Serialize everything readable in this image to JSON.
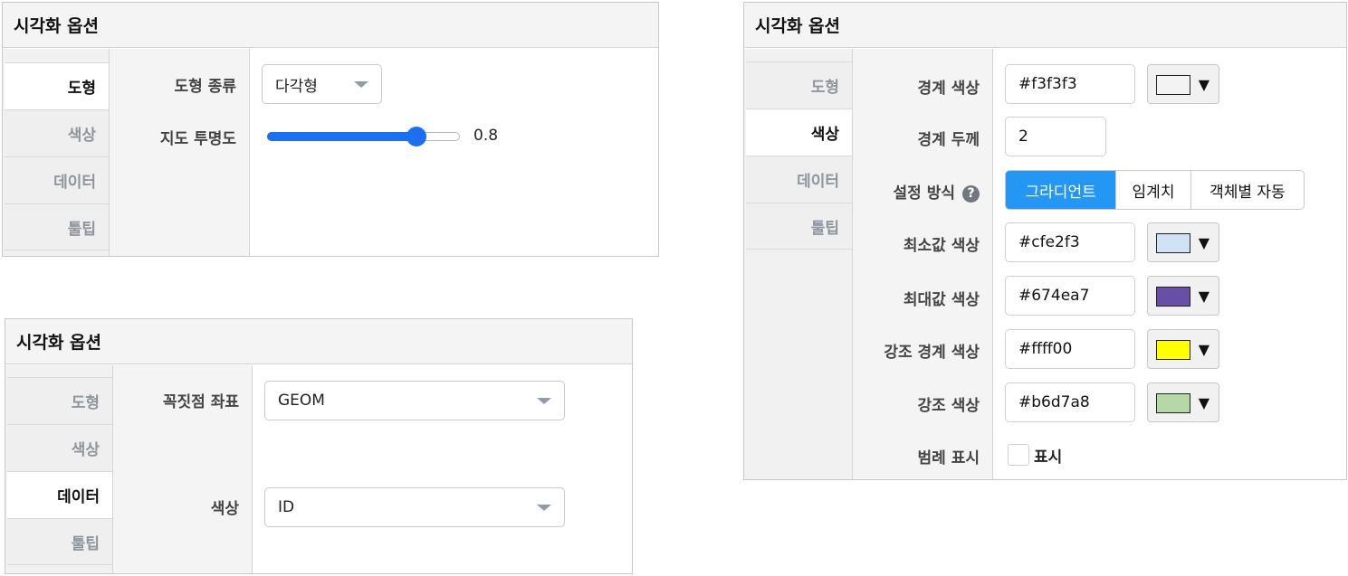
{
  "panels": {
    "shape": {
      "title": "시각화 옵션",
      "tabs": [
        "도형",
        "색상",
        "데이터",
        "툴팁"
      ],
      "fields": {
        "shape_type_label": "도형 종류",
        "shape_type_value": "다각형",
        "opacity_label": "지도 투명도",
        "opacity_value": "0.8",
        "opacity_level": 0.8
      }
    },
    "data": {
      "title": "시각화 옵션",
      "tabs": [
        "도형",
        "색상",
        "데이터",
        "툴팁"
      ],
      "fields": {
        "vertex_label": "꼭짓점 좌표",
        "vertex_value": "GEOM",
        "color_label": "색상",
        "color_value": "ID"
      }
    },
    "color": {
      "title": "시각화 옵션",
      "tabs": [
        "도형",
        "색상",
        "데이터",
        "툴팁"
      ],
      "fields": {
        "border_color_label": "경계 색상",
        "border_color_value": "#f3f3f3",
        "border_width_label": "경계 두께",
        "border_width_value": "2",
        "mode_label": "설정 방식",
        "mode_options": [
          "그라디언트",
          "임계치",
          "객체별 자동"
        ],
        "min_color_label": "최소값 색상",
        "min_color_value": "#cfe2f3",
        "max_color_label": "최대값 색상",
        "max_color_value": "#674ea7",
        "hl_border_label": "강조 경계 색상",
        "hl_border_value": "#ffff00",
        "hl_color_label": "강조 색상",
        "hl_color_value": "#b6d7a8",
        "legend_label": "범례 표시",
        "legend_check_label": "표시"
      }
    }
  },
  "colors": {
    "accent": "#2496f3",
    "slider": "#1d6ff2",
    "border_swatch": "#f3f3f3",
    "min_swatch": "#cfe2f3",
    "max_swatch": "#674ea7",
    "hl_border_swatch": "#ffff00",
    "hl_color_swatch": "#b6d7a8"
  },
  "icons": {
    "caret": "caret-down-icon",
    "help": "question-circle-icon",
    "help_glyph": "?",
    "swatch_arrow": "▼"
  }
}
